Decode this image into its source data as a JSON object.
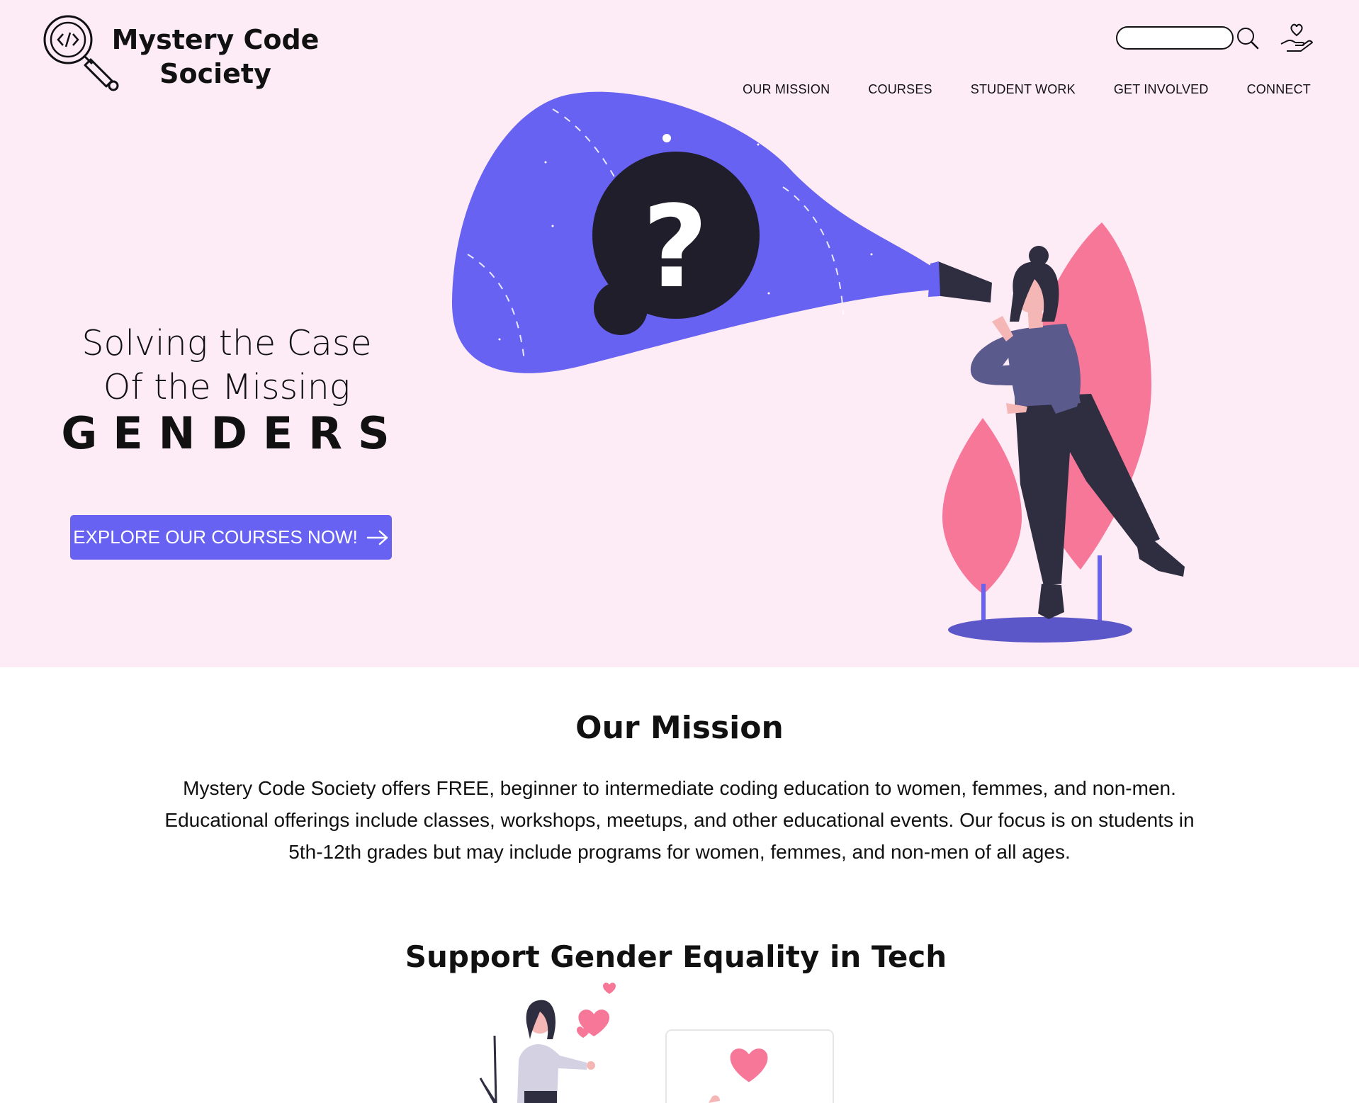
{
  "brand": {
    "name_line1": "Mystery Code",
    "name_line2": "Society"
  },
  "header": {
    "search_placeholder": "",
    "nav": [
      {
        "label": "OUR MISSION"
      },
      {
        "label": "COURSES"
      },
      {
        "label": "STUDENT WORK"
      },
      {
        "label": "GET INVOLVED"
      },
      {
        "label": "CONNECT"
      }
    ]
  },
  "hero": {
    "line1": "Solving the Case",
    "line2": "Of the Missing",
    "line3": "GENDERS",
    "cta_label": "EXPLORE OUR COURSES NOW!"
  },
  "mission": {
    "title": "Our Mission",
    "text": "Mystery Code Society offers FREE, beginner to intermediate coding education to women, femmes, and non-men. Educational offerings include classes, workshops, meetups, and other educational events. Our focus is on students in 5th-12th grades but may include programs for women, femmes, and non-men of all ages."
  },
  "support": {
    "title": "Support Gender Equality in Tech"
  },
  "colors": {
    "header_bg": "#fdebf6",
    "accent": "#6762f1",
    "pink": "#f77799",
    "dark": "#2f2e41"
  },
  "icons": [
    "logo-magnifier-code-icon",
    "search-icon",
    "donate-hand-heart-icon",
    "arrow-right-icon"
  ]
}
